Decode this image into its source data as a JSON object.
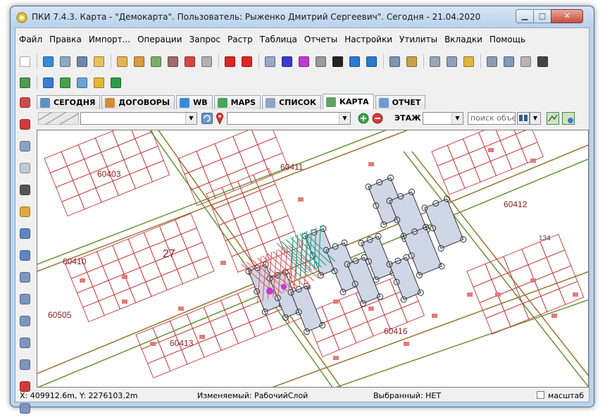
{
  "window": {
    "title": "ПКИ 7.4.3. Карта - \"Демокарта\". Пользователь: Рыженко Дмитрий Сергеевич\". Сегодня - 21.04.2020",
    "min_glyph": "▁",
    "max_glyph": "□",
    "close_glyph": "✕"
  },
  "menu": [
    "Файл",
    "Правка",
    "Импорт...",
    "Операции",
    "Запрос",
    "Растр",
    "Таблица",
    "Отчеты",
    "Настройки",
    "Утилиты",
    "Вкладки",
    "Помощь"
  ],
  "toolbar_icons": [
    {
      "name": "new-doc-icon",
      "color": "#ffffff"
    },
    {
      "name": "globe-icon",
      "color": "#3a8bd6"
    },
    {
      "name": "form-icon",
      "color": "#8fa9c5"
    },
    {
      "name": "print-icon",
      "color": "#6d88a8"
    },
    {
      "name": "copy-icon",
      "color": "#e7c15a"
    },
    {
      "name": "open-folder-icon",
      "color": "#e3b44f"
    },
    {
      "name": "save-folder-icon",
      "color": "#d69a3d"
    },
    {
      "name": "export-icon",
      "color": "#7ab06a"
    },
    {
      "name": "layers-icon",
      "color": "#a06a6a"
    },
    {
      "name": "chart-icon",
      "color": "#d64545"
    },
    {
      "name": "edit-icon",
      "color": "#b1b1b1"
    },
    {
      "name": "select-red-icon",
      "color": "#e02424"
    },
    {
      "name": "select-add-icon",
      "color": "#e02424"
    },
    {
      "name": "object-copy-icon",
      "color": "#9aa7c8"
    },
    {
      "name": "node-edit-icon",
      "color": "#3a3ad0"
    },
    {
      "name": "node-move-icon",
      "color": "#c23bd0"
    },
    {
      "name": "shape-icon",
      "color": "#9a9a9a"
    },
    {
      "name": "point-icon",
      "color": "#222222"
    },
    {
      "name": "globe-search-icon",
      "color": "#2b7bd2"
    },
    {
      "name": "globe-layer-icon",
      "color": "#2b7bd2"
    },
    {
      "name": "table-icon",
      "color": "#7f93b3"
    },
    {
      "name": "brush-icon",
      "color": "#c9a04a"
    },
    {
      "name": "duplicate-icon",
      "color": "#9aa5b4"
    },
    {
      "name": "stack-icon",
      "color": "#8fa0b8"
    },
    {
      "name": "upload-icon",
      "color": "#e0b53f"
    },
    {
      "name": "window-icon",
      "color": "#8d9bb2"
    },
    {
      "name": "image-icon",
      "color": "#7c9bb9"
    },
    {
      "name": "pages-icon",
      "color": "#b5b5b5"
    },
    {
      "name": "pencil-icon",
      "color": "#444444"
    }
  ],
  "toolbar2_icons": [
    {
      "name": "map-view-icon",
      "color": "#4d9a4d"
    },
    {
      "name": "info-icon",
      "color": "#3a7dd1"
    },
    {
      "name": "arrow-green-icon",
      "color": "#47a047"
    },
    {
      "name": "arrow-refresh-icon",
      "color": "#6aa3d8"
    },
    {
      "name": "lock-icon",
      "color": "#e6b730"
    },
    {
      "name": "forward-icon",
      "color": "#2e9b4a"
    }
  ],
  "tabs": [
    {
      "label": "СЕГОДНЯ",
      "icon": "calendar-icon",
      "color": "#5f8fc7"
    },
    {
      "label": "ДОГОВОРЫ",
      "icon": "handshake-icon",
      "color": "#d28b3a"
    },
    {
      "label": "WB",
      "icon": "web-icon",
      "color": "#3a8bd6"
    },
    {
      "label": "MAPS",
      "icon": "maps-icon",
      "color": "#48a45a"
    },
    {
      "label": "СПИСОК",
      "icon": "list-icon",
      "color": "#8da3c0"
    },
    {
      "label": "КАРТА",
      "icon": "map-icon",
      "color": "#5ea35e",
      "active": true
    },
    {
      "label": "ОТЧЕТ",
      "icon": "report-icon",
      "color": "#6b9bd2"
    }
  ],
  "left_tools": [
    {
      "name": "crosshair-icon",
      "color": "#d04a4a"
    },
    {
      "name": "stop-icon",
      "color": "#d23a3a"
    },
    {
      "name": "pointer-icon",
      "color": "#8aa2c6"
    },
    {
      "name": "zoom-window-icon",
      "color": "#c0c9d8"
    },
    {
      "name": "select-pointer-icon",
      "color": "#555555"
    },
    {
      "name": "hand-icon",
      "color": "#e1a93c"
    },
    {
      "name": "zoom-in-icon",
      "color": "#5d87c2"
    },
    {
      "name": "zoom-out-icon",
      "color": "#5d87c2"
    },
    {
      "name": "polygon-icon",
      "color": "#7c96bf"
    },
    {
      "name": "polyline-icon",
      "color": "#7c96bf"
    },
    {
      "name": "circle-icon",
      "color": "#7c96bf"
    },
    {
      "name": "rectangle-icon",
      "color": "#7c96bf"
    },
    {
      "name": "curve-icon",
      "color": "#7c96bf"
    },
    {
      "name": "pin-icon",
      "color": "#d23a3a"
    },
    {
      "name": "text-icon",
      "color": "#7c96bf"
    }
  ],
  "map_toolbar": {
    "floor_label": "ЭТАЖ",
    "search_placeholder": "поиск объект"
  },
  "map": {
    "labels": [
      {
        "text": "60403"
      },
      {
        "text": "60411"
      },
      {
        "text": "60412"
      },
      {
        "text": "60410"
      },
      {
        "text": "27"
      },
      {
        "text": "60505"
      },
      {
        "text": "60413"
      },
      {
        "text": "60416"
      },
      {
        "text": "134"
      }
    ]
  },
  "status": {
    "coords": "X: 409912.6m, Y: 2276103.2m",
    "editable": "Изменяемый: РабочийСлой",
    "selected": "Выбранный: НЕТ",
    "scale_label": "масштаб"
  }
}
